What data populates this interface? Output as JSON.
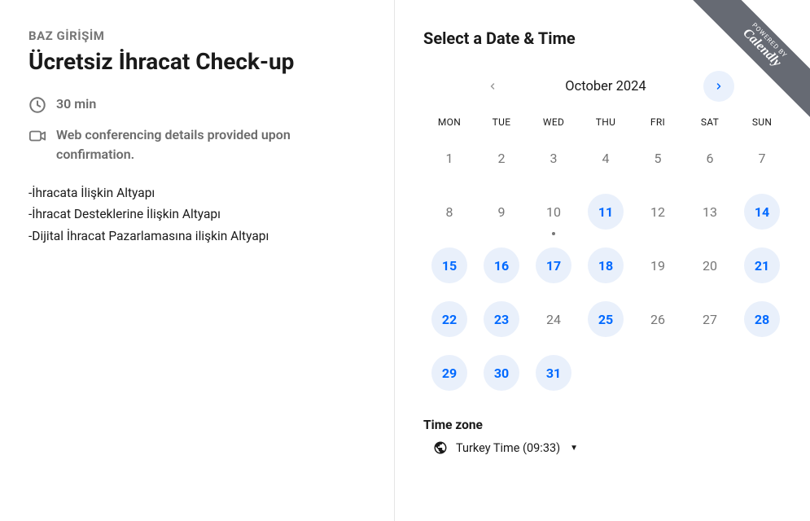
{
  "ribbon": {
    "powered": "POWERED BY",
    "brand": "Calendly"
  },
  "left": {
    "company": "BAZ GİRİŞİM",
    "title": "Ücretsiz İhracat Check-up",
    "duration": "30 min",
    "location": "Web conferencing details provided upon confirmation.",
    "desc_line1": "-İhracata İlişkin Altyapı",
    "desc_line2": "-İhracat Desteklerine İlişkin Altyapı",
    "desc_line3": "-Dijital İhracat Pazarlamasına ilişkin Altyapı"
  },
  "right": {
    "title": "Select a Date & Time",
    "month": "October 2024",
    "weekdays": [
      "MON",
      "TUE",
      "WED",
      "THU",
      "FRI",
      "SAT",
      "SUN"
    ],
    "tz_label": "Time zone",
    "tz_value": "Turkey Time (09:33)"
  },
  "calendar": {
    "leading_blanks": 0,
    "days": [
      {
        "n": "1",
        "avail": false,
        "today": false
      },
      {
        "n": "2",
        "avail": false,
        "today": false
      },
      {
        "n": "3",
        "avail": false,
        "today": false
      },
      {
        "n": "4",
        "avail": false,
        "today": false
      },
      {
        "n": "5",
        "avail": false,
        "today": false
      },
      {
        "n": "6",
        "avail": false,
        "today": false
      },
      {
        "n": "7",
        "avail": false,
        "today": false
      },
      {
        "n": "8",
        "avail": false,
        "today": false
      },
      {
        "n": "9",
        "avail": false,
        "today": false
      },
      {
        "n": "10",
        "avail": false,
        "today": true
      },
      {
        "n": "11",
        "avail": true,
        "today": false
      },
      {
        "n": "12",
        "avail": false,
        "today": false
      },
      {
        "n": "13",
        "avail": false,
        "today": false
      },
      {
        "n": "14",
        "avail": true,
        "today": false
      },
      {
        "n": "15",
        "avail": true,
        "today": false
      },
      {
        "n": "16",
        "avail": true,
        "today": false
      },
      {
        "n": "17",
        "avail": true,
        "today": false
      },
      {
        "n": "18",
        "avail": true,
        "today": false
      },
      {
        "n": "19",
        "avail": false,
        "today": false
      },
      {
        "n": "20",
        "avail": false,
        "today": false
      },
      {
        "n": "21",
        "avail": true,
        "today": false
      },
      {
        "n": "22",
        "avail": true,
        "today": false
      },
      {
        "n": "23",
        "avail": true,
        "today": false
      },
      {
        "n": "24",
        "avail": false,
        "today": false
      },
      {
        "n": "25",
        "avail": true,
        "today": false
      },
      {
        "n": "26",
        "avail": false,
        "today": false
      },
      {
        "n": "27",
        "avail": false,
        "today": false
      },
      {
        "n": "28",
        "avail": true,
        "today": false
      },
      {
        "n": "29",
        "avail": true,
        "today": false
      },
      {
        "n": "30",
        "avail": true,
        "today": false
      },
      {
        "n": "31",
        "avail": true,
        "today": false
      }
    ]
  }
}
